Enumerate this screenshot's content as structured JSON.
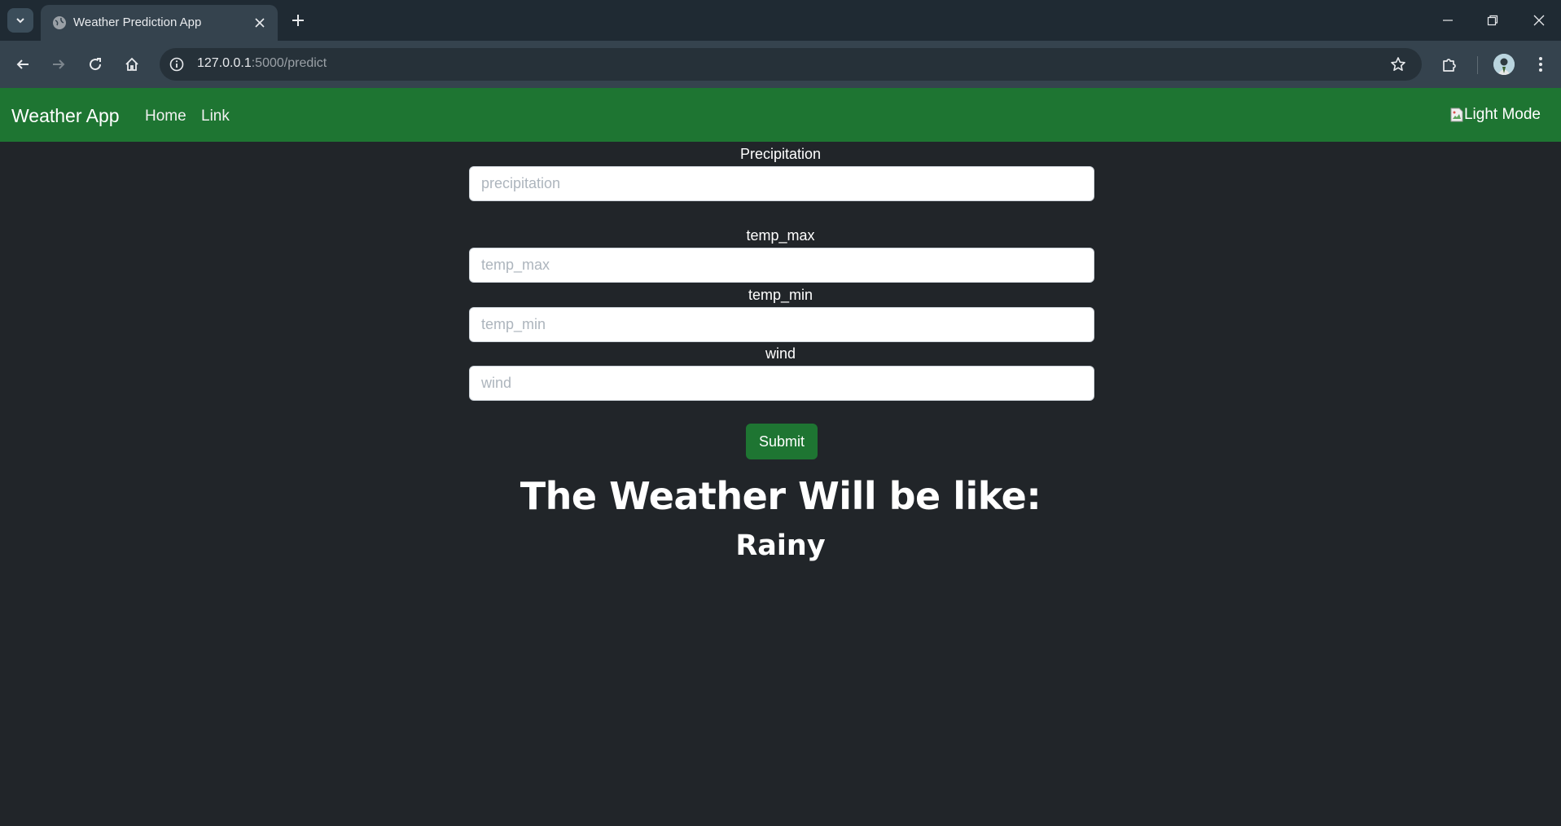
{
  "browser": {
    "tab_title": "Weather Prediction App",
    "url_host": "127.0.0.1",
    "url_path": ":5000/predict"
  },
  "navbar": {
    "brand": "Weather App",
    "links": [
      "Home",
      "Link"
    ],
    "mode_toggle_alt": "Light Mode",
    "color": "#1e7532"
  },
  "form": {
    "fields": [
      {
        "label": "Precipitation",
        "placeholder": "precipitation",
        "value": ""
      },
      {
        "label": "temp_max",
        "placeholder": "temp_max",
        "value": ""
      },
      {
        "label": "temp_min",
        "placeholder": "temp_min",
        "value": ""
      },
      {
        "label": "wind",
        "placeholder": "wind",
        "value": ""
      }
    ],
    "submit_label": "Submit"
  },
  "result": {
    "heading": "The Weather Will be like:",
    "value": "Rainy"
  },
  "colors": {
    "page_background": "#212529",
    "accent": "#1e7532"
  }
}
